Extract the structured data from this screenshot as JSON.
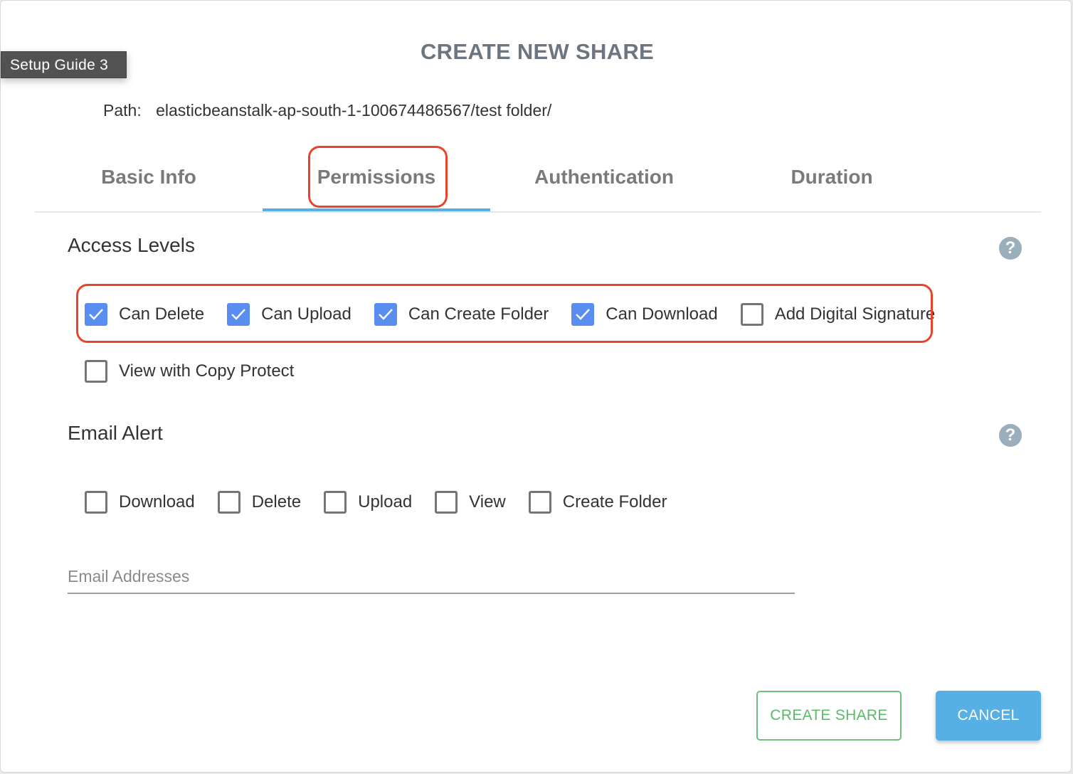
{
  "guide_badge": "Setup Guide 3",
  "dialog": {
    "title": "CREATE NEW SHARE",
    "path_label": "Path:",
    "path_value": "elasticbeanstalk-ap-south-1-100674486567/test folder/"
  },
  "tabs": [
    {
      "label": "Basic Info",
      "active": false
    },
    {
      "label": "Permissions",
      "active": true
    },
    {
      "label": "Authentication",
      "active": false
    },
    {
      "label": "Duration",
      "active": false
    }
  ],
  "access_levels": {
    "title": "Access Levels",
    "help_icon": "?",
    "options": [
      {
        "label": "Can Delete",
        "checked": true
      },
      {
        "label": "Can Upload",
        "checked": true
      },
      {
        "label": "Can Create Folder",
        "checked": true
      },
      {
        "label": "Can Download",
        "checked": true
      },
      {
        "label": "Add Digital Signature",
        "checked": false
      },
      {
        "label": "View with Copy Protect",
        "checked": false
      }
    ]
  },
  "email_alert": {
    "title": "Email Alert",
    "help_icon": "?",
    "options": [
      {
        "label": "Download",
        "checked": false
      },
      {
        "label": "Delete",
        "checked": false
      },
      {
        "label": "Upload",
        "checked": false
      },
      {
        "label": "View",
        "checked": false
      },
      {
        "label": "Create Folder",
        "checked": false
      }
    ],
    "email_placeholder": "Email Addresses",
    "email_value": ""
  },
  "buttons": {
    "create_label": "CREATE SHARE",
    "cancel_label": "CANCEL"
  },
  "colors": {
    "accent_blue": "#56b0e6",
    "checkbox_blue": "#5a8df0",
    "create_green": "#5cb86c",
    "annotation_red": "#e8442b",
    "title_gray": "#6c7580"
  }
}
